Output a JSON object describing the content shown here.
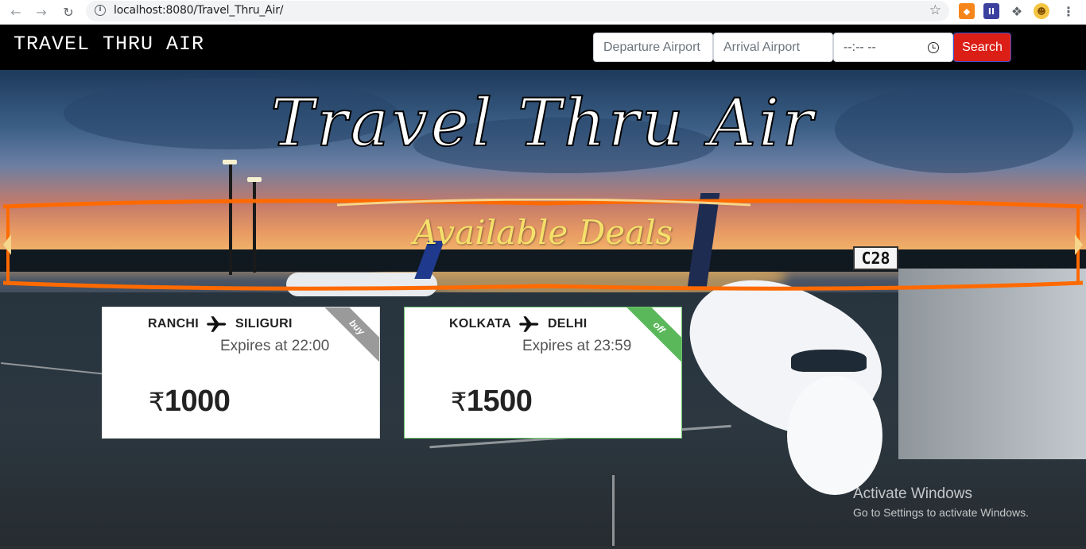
{
  "browser": {
    "url": "localhost:8080/Travel_Thru_Air/",
    "icons": [
      "back-icon",
      "forward-icon",
      "reload-icon",
      "info-icon",
      "star-icon",
      "metamask-extension-icon",
      "extension-icon",
      "puzzle-icon",
      "profile-avatar-icon",
      "menu-icon"
    ]
  },
  "header": {
    "brand": "TRAVEL THRU AIR",
    "departure_placeholder": "Departure Airport",
    "arrival_placeholder": "Arrival Airport",
    "time_value": "--:-- --",
    "search_label": "Search"
  },
  "hero": {
    "title": "Travel Thru Air",
    "deals_heading": "Available Deals",
    "gate_sign": "C28"
  },
  "deals": [
    {
      "from": "RANCHI",
      "to": "SILIGURI",
      "expires": "Expires at 22:00",
      "currency": "₹",
      "price": "1000",
      "ribbon": "buy",
      "ribbon_color": "#9a9a9a"
    },
    {
      "from": "KOLKATA",
      "to": "DELHI",
      "expires": "Expires at 23:59",
      "currency": "₹",
      "price": "1500",
      "ribbon": "off",
      "ribbon_color": "#5bb85a"
    }
  ],
  "colors": {
    "header_bg": "#000000",
    "search_button": "#dc1f16",
    "deals_heading": "#f5e06a",
    "banner_stroke": "#ff6a00"
  },
  "os_watermark": {
    "title": "Activate Windows",
    "subtitle": "Go to Settings to activate Windows."
  }
}
